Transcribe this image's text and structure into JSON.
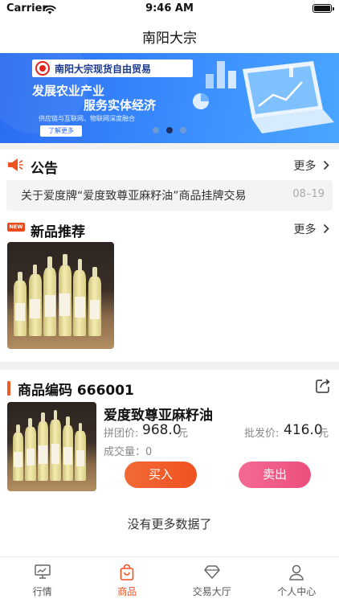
{
  "status_bar": {
    "carrier": "Carrier",
    "time": "9:46 AM"
  },
  "nav": {
    "title": "南阳大宗"
  },
  "banner": {
    "brand": "南阳大宗现货自由贸易",
    "slogan_line1": "发展农业产业",
    "slogan_line2": "服务实体经济",
    "slogan_line3": "供应链与互联网、物联网深度融合",
    "button": "了解更多",
    "page_count": 3,
    "active_page": 2
  },
  "notice": {
    "title": "公告",
    "more": "更多",
    "item_text": "关于爱度牌“爱度致尊亚麻籽油”商品挂牌交易",
    "item_date": "08–19"
  },
  "new_products": {
    "badge": "NEW",
    "title": "新品推荐",
    "more": "更多"
  },
  "product": {
    "code_label": "商品编码 666001",
    "name": "爱度致尊亚麻籽油",
    "group_price_label": "拼团价:",
    "group_price": "968.0",
    "group_price_unit": "元",
    "wholesale_label": "批发价:",
    "wholesale_price": "416.0",
    "wholesale_unit": "元",
    "volume": "成交量：0",
    "buy": "买入",
    "sell": "卖出"
  },
  "footer_note": "没有更多数据了",
  "tabs": [
    {
      "label": "行情",
      "icon": "monitor-icon",
      "active": false
    },
    {
      "label": "商品",
      "icon": "shopping-bag-icon",
      "active": true
    },
    {
      "label": "交易大厅",
      "icon": "diamond-icon",
      "active": false
    },
    {
      "label": "个人中心",
      "icon": "user-icon",
      "active": false
    }
  ],
  "colors": {
    "accent": "#ef5221",
    "sell": "#ec4f7c",
    "banner": "#2a6bf0"
  }
}
